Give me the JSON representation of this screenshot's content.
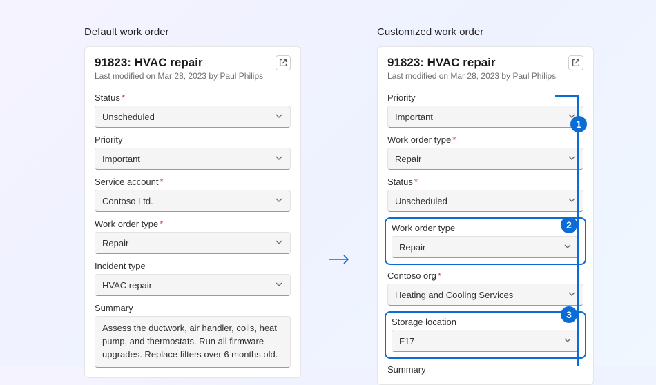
{
  "colors": {
    "accent": "#0b6cd6",
    "required": "#d13438"
  },
  "left": {
    "title": "Default work order",
    "header": {
      "title": "91823: HVAC repair",
      "subtitle": "Last modified on Mar 28, 2023 by Paul Philips"
    },
    "status": {
      "label": "Status",
      "required": true,
      "value": "Unscheduled"
    },
    "priority": {
      "label": "Priority",
      "required": false,
      "value": "Important"
    },
    "serviceAccount": {
      "label": "Service account",
      "required": true,
      "value": "Contoso Ltd."
    },
    "workOrderType": {
      "label": "Work order type",
      "required": true,
      "value": "Repair"
    },
    "incidentType": {
      "label": "Incident type",
      "required": false,
      "value": "HVAC repair"
    },
    "summary": {
      "label": "Summary",
      "value": "Assess the ductwork, air handler, coils, heat pump, and thermostats. Run all firmware upgrades. Replace filters over 6 months old."
    }
  },
  "right": {
    "title": "Customized work order",
    "header": {
      "title": "91823: HVAC repair",
      "subtitle": "Last modified on Mar 28, 2023 by Paul Philips"
    },
    "priority": {
      "label": "Priority",
      "required": false,
      "value": "Important"
    },
    "workOrderTypeA": {
      "label": "Work order type",
      "required": true,
      "value": "Repair"
    },
    "status": {
      "label": "Status",
      "required": true,
      "value": "Unscheduled"
    },
    "workOrderTypeB": {
      "label": "Work order type",
      "required": false,
      "value": "Repair"
    },
    "contosoOrg": {
      "label": "Contoso org",
      "required": true,
      "value": "Heating and Cooling Services"
    },
    "storageLocation": {
      "label": "Storage location",
      "required": false,
      "value": "F17"
    },
    "summary": {
      "label": "Summary"
    }
  },
  "callouts": {
    "c1": "1",
    "c2": "2",
    "c3": "3"
  }
}
